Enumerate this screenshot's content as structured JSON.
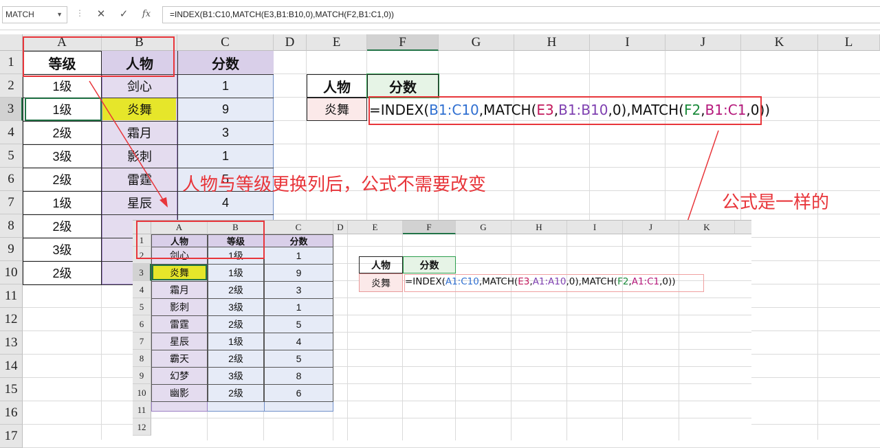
{
  "formula_bar": {
    "name_box": "MATCH",
    "cancel_icon": "✕",
    "enter_icon": "✓",
    "fx_label": "fx",
    "formula": "=INDEX(B1:C10,MATCH(E3,B1:B10,0),MATCH(F2,B1:C1,0))"
  },
  "main_sheet": {
    "columns": [
      "A",
      "B",
      "C",
      "D",
      "E",
      "F",
      "G",
      "H",
      "I",
      "J",
      "K",
      "L"
    ],
    "rows": [
      "1",
      "2",
      "3",
      "4",
      "5",
      "6",
      "7",
      "8",
      "9",
      "10",
      "11",
      "12",
      "13",
      "14",
      "15",
      "16",
      "17"
    ],
    "header": {
      "level": "等级",
      "person": "人物",
      "score": "分数"
    },
    "table": [
      {
        "level": "1级",
        "person": "剑心",
        "score": "1"
      },
      {
        "level": "1级",
        "person": "炎舞",
        "score": "9"
      },
      {
        "level": "2级",
        "person": "霜月",
        "score": "3"
      },
      {
        "level": "3级",
        "person": "影刺",
        "score": "1"
      },
      {
        "level": "2级",
        "person": "雷霆",
        "score": "5"
      },
      {
        "level": "1级",
        "person": "星辰",
        "score": "4"
      },
      {
        "level": "2级",
        "person": "霸",
        "score": ""
      },
      {
        "level": "3级",
        "person": "幻",
        "score": ""
      },
      {
        "level": "2级",
        "person": "幽",
        "score": ""
      }
    ],
    "lookup": {
      "person_label": "人物",
      "score_label": "分数",
      "person_value": "炎舞"
    },
    "formula_parts": [
      {
        "t": "=INDEX(",
        "c": "#111111"
      },
      {
        "t": "B1:C10",
        "c": "#2f6fd1"
      },
      {
        "t": ",MATCH(",
        "c": "#111111"
      },
      {
        "t": "E3",
        "c": "#c2185b"
      },
      {
        "t": ",",
        "c": "#111111"
      },
      {
        "t": "B1:B10",
        "c": "#7e3fb0"
      },
      {
        "t": ",0),MATCH(",
        "c": "#111111"
      },
      {
        "t": "F2",
        "c": "#1a8a3a"
      },
      {
        "t": ",",
        "c": "#111111"
      },
      {
        "t": "B1:C1",
        "c": "#b5187b"
      },
      {
        "t": ",0))",
        "c": "#111111"
      }
    ]
  },
  "annotations": {
    "note_main": "人物与等级更换列后，公式不需要改变",
    "note_same": "公式是一样的"
  },
  "inset_sheet": {
    "columns": [
      "A",
      "B",
      "C",
      "D",
      "E",
      "F",
      "G",
      "H",
      "I",
      "J",
      "K"
    ],
    "rows": [
      "1",
      "2",
      "3",
      "4",
      "5",
      "6",
      "7",
      "8",
      "9",
      "10",
      "11",
      "12"
    ],
    "header": {
      "person": "人物",
      "level": "等级",
      "score": "分数"
    },
    "table": [
      {
        "person": "剑心",
        "level": "1级",
        "score": "1"
      },
      {
        "person": "炎舞",
        "level": "1级",
        "score": "9"
      },
      {
        "person": "霜月",
        "level": "2级",
        "score": "3"
      },
      {
        "person": "影刺",
        "level": "3级",
        "score": "1"
      },
      {
        "person": "雷霆",
        "level": "2级",
        "score": "5"
      },
      {
        "person": "星辰",
        "level": "1级",
        "score": "4"
      },
      {
        "person": "霸天",
        "level": "2级",
        "score": "5"
      },
      {
        "person": "幻梦",
        "level": "3级",
        "score": "8"
      },
      {
        "person": "幽影",
        "level": "2级",
        "score": "6"
      }
    ],
    "lookup": {
      "person_label": "人物",
      "score_label": "分数",
      "person_value": "炎舞"
    },
    "formula_parts": [
      {
        "t": "=INDEX(",
        "c": "#111111"
      },
      {
        "t": "A1:C10",
        "c": "#2f6fd1"
      },
      {
        "t": ",MATCH(",
        "c": "#111111"
      },
      {
        "t": "E3",
        "c": "#c2185b"
      },
      {
        "t": ",",
        "c": "#111111"
      },
      {
        "t": "A1:A10",
        "c": "#7e3fb0"
      },
      {
        "t": ",0),MATCH(",
        "c": "#111111"
      },
      {
        "t": "F2",
        "c": "#1a8a3a"
      },
      {
        "t": ",",
        "c": "#111111"
      },
      {
        "t": "A1:C1",
        "c": "#b5187b"
      },
      {
        "t": ",0))",
        "c": "#111111"
      }
    ]
  },
  "colors": {
    "accent_red": "#e8353a",
    "person_fill": "#e4dcef",
    "score_fill": "#e6ebf7",
    "highlight_yellow": "#e6e62a",
    "lookup_person_fill": "#fbe9e9",
    "lookup_score_fill": "#e6f4e6"
  }
}
